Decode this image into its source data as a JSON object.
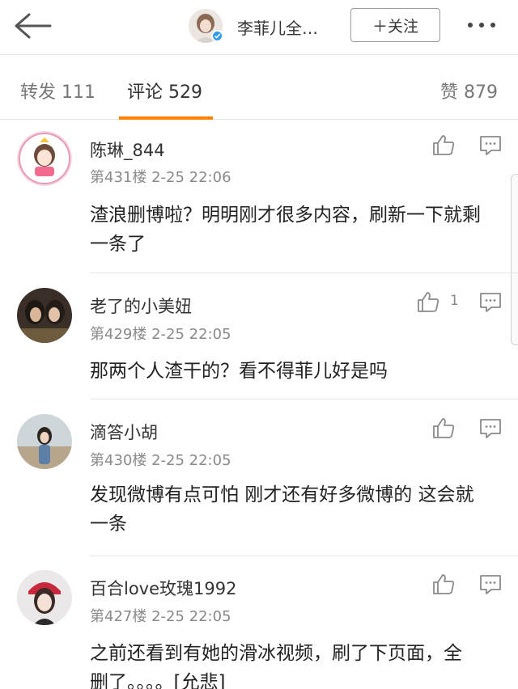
{
  "header": {
    "title": "李菲儿全…",
    "follow_label": "＋关注"
  },
  "tabs": {
    "repost": "转发 111",
    "comment": "评论 529",
    "like": "赞 879"
  },
  "comments": [
    {
      "name": "陈琳_844",
      "meta": "第431楼  2-25 22:06",
      "text": "渣浪删博啦？明明刚才很多内容，刷新一下就剩一条了",
      "likes": ""
    },
    {
      "name": "老了的小美妞",
      "meta": "第429楼  2-25 22:05",
      "text": "那两个人渣干的？看不得菲儿好是吗",
      "likes": "1"
    },
    {
      "name": "滴答小胡",
      "meta": "第430楼  2-25 22:05",
      "text": "发现微博有点可怕 刚才还有好多微博的 这会就一条",
      "likes": ""
    },
    {
      "name": "百合love玫瑰1992",
      "meta": "第427楼  2-25 22:05",
      "text": "之前还看到有她的滑冰视频，刷了下页面，全删了。。。。[允悲]",
      "likes": ""
    }
  ],
  "colors": {
    "accent": "#ff8200",
    "verified": "#2d9cf0",
    "meta_text": "#8a8a8a"
  }
}
